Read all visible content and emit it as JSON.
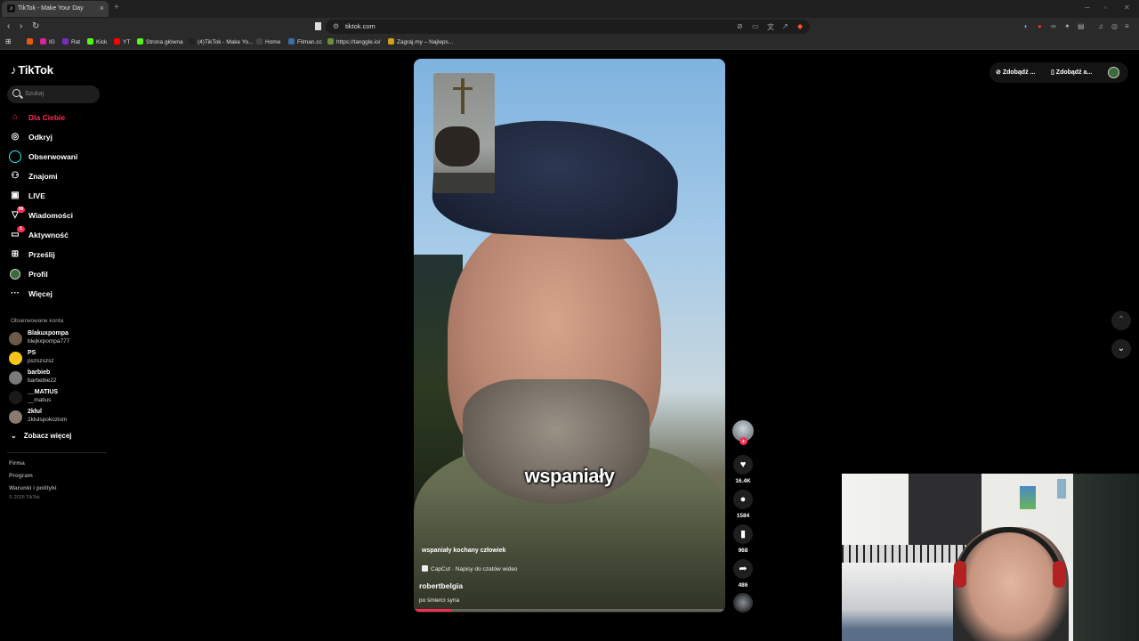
{
  "browser": {
    "tab_title": "TikTok - Make Your Day",
    "tab_close": "×",
    "new_tab": "+",
    "url": "tiktok.com",
    "bookmarks": [
      {
        "label": "",
        "color": "#e8590c"
      },
      {
        "label": "IG",
        "color": "#d6249f"
      },
      {
        "label": "Rat",
        "color": "#7b2cbf"
      },
      {
        "label": "Kick",
        "color": "#53fc18"
      },
      {
        "label": "YT",
        "color": "#ff0000"
      },
      {
        "label": "Strona główna",
        "color": "#53fc18"
      },
      {
        "label": "(4)TikTok - Make Yo...",
        "color": "#222222"
      },
      {
        "label": "Home",
        "color": "#444444"
      },
      {
        "label": "Filman.cc",
        "color": "#3a6ea5"
      },
      {
        "label": "https://tanggle.io/",
        "color": "#6a8f3a"
      },
      {
        "label": "Zagraj.my – Najleps...",
        "color": "#d4a017"
      }
    ]
  },
  "sidebar": {
    "logo": "TikTok",
    "search_placeholder": "Szukaj",
    "nav": [
      {
        "label": "Dla Ciebie",
        "icon": "home-icon",
        "active": true
      },
      {
        "label": "Odkryj",
        "icon": "compass-icon"
      },
      {
        "label": "Obserwowani",
        "icon": "following-icon"
      },
      {
        "label": "Znajomi",
        "icon": "friends-icon"
      },
      {
        "label": "LIVE",
        "icon": "live-icon"
      },
      {
        "label": "Wiadomości",
        "icon": "messages-icon",
        "badge": "99"
      },
      {
        "label": "Aktywność",
        "icon": "activity-icon",
        "badge": "1"
      },
      {
        "label": "Prześlij",
        "icon": "upload-icon"
      },
      {
        "label": "Profil",
        "icon": "profile-icon"
      },
      {
        "label": "Więcej",
        "icon": "more-icon"
      }
    ],
    "followed_title": "Obserwowane konta",
    "followed": [
      {
        "name": "Blakuxpompa",
        "handle": "blejkxpompa777"
      },
      {
        "name": "PS",
        "handle": "pszszszsz"
      },
      {
        "name": "barbieb",
        "handle": "barbebie22"
      },
      {
        "name": "__MATIUS",
        "handle": "__matius"
      },
      {
        "name": "2kłul",
        "handle": "2klulspokoziom"
      }
    ],
    "see_more": "Zobacz więcej",
    "footer": [
      "Firma",
      "Program",
      "Warunki i polityki"
    ],
    "copyright": "© 2026 TikTok"
  },
  "video": {
    "subtitle": "wspaniały",
    "description": "wspaniały kochany człowiek",
    "capcut": "CapCut · Napisy do czatów wideo",
    "author": "robertbelgia",
    "sound": "po śmierci syna",
    "progress_percent": 12
  },
  "actions": {
    "like_count": "16.4K",
    "comment_count": "1584",
    "save_count": "968",
    "share_count": "486",
    "plus": "+"
  },
  "topbar": {
    "get_coins": "Zdobądź ...",
    "get_app": "Zdobądź a..."
  },
  "colors": {
    "accent": "#fe2c55",
    "background": "#000000"
  }
}
